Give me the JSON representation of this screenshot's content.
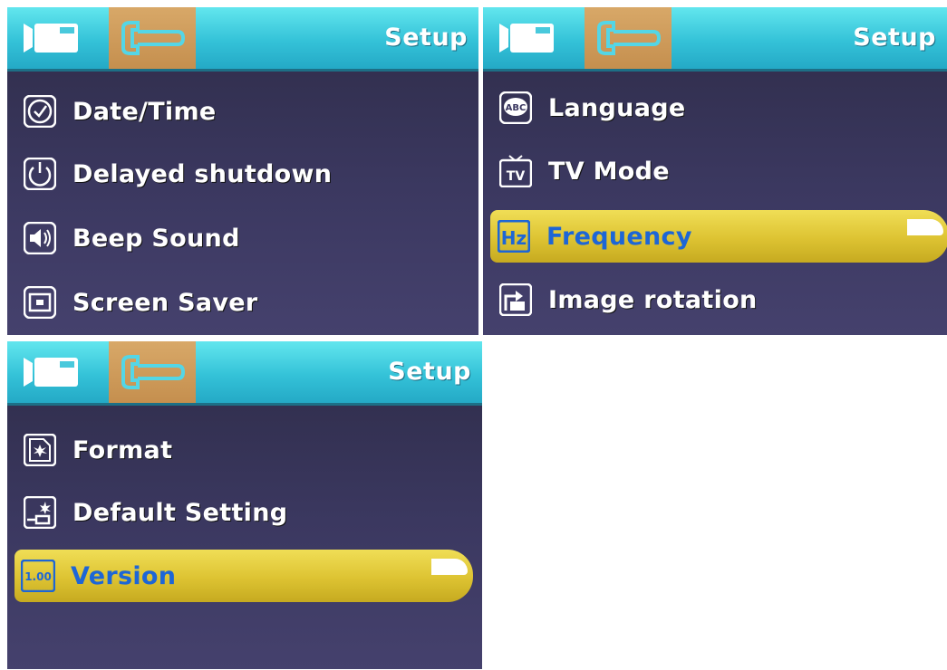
{
  "colors": {
    "header_bg": "#3cc8dc",
    "active_tab_bg": "#c99652",
    "menu_bg": "#3a3760",
    "selection_bg": "#e2c83a",
    "selected_text": "#1d66d6",
    "text": "#ffffff"
  },
  "screens": [
    {
      "title": "Setup",
      "tabs": [
        {
          "icon": "video-camera-icon",
          "active": false
        },
        {
          "icon": "wrench-icon",
          "active": true
        }
      ],
      "items": [
        {
          "label": "Date/Time",
          "icon": "clock-icon",
          "selected": false
        },
        {
          "label": "Delayed shutdown",
          "icon": "power-icon",
          "selected": false
        },
        {
          "label": "Beep Sound",
          "icon": "speaker-icon",
          "selected": false
        },
        {
          "label": "Screen Saver",
          "icon": "screen-icon",
          "selected": false
        }
      ]
    },
    {
      "title": "Setup",
      "tabs": [
        {
          "icon": "video-camera-icon",
          "active": false
        },
        {
          "icon": "wrench-icon",
          "active": true
        }
      ],
      "items": [
        {
          "label": "Language",
          "icon": "language-abc-icon",
          "icon_text": "ABC",
          "selected": false
        },
        {
          "label": "TV Mode",
          "icon": "tv-icon",
          "icon_text": "TV",
          "selected": false
        },
        {
          "label": "Frequency",
          "icon": "hz-icon",
          "icon_text": "Hz",
          "selected": true
        },
        {
          "label": "Image rotation",
          "icon": "rotation-icon",
          "selected": false
        }
      ]
    },
    {
      "title": "Setup",
      "tabs": [
        {
          "icon": "video-camera-icon",
          "active": false
        },
        {
          "icon": "wrench-icon",
          "active": true
        }
      ],
      "items": [
        {
          "label": "Format",
          "icon": "format-icon",
          "selected": false
        },
        {
          "label": "Default Setting",
          "icon": "default-setting-icon",
          "selected": false
        },
        {
          "label": "Version",
          "icon": "version-icon",
          "icon_text": "1.00",
          "selected": true
        }
      ]
    }
  ]
}
